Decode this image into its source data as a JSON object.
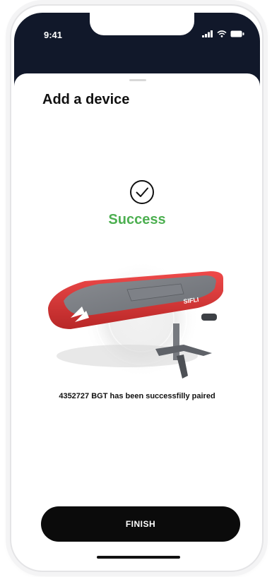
{
  "status_bar": {
    "time": "9:41",
    "icons": [
      "signal-icon",
      "wifi-icon",
      "battery-icon"
    ]
  },
  "header": {
    "title": "Add a device"
  },
  "result": {
    "icon": "check-circle-icon",
    "status": "Success",
    "status_color": "#4caf50",
    "message": "4352727 BGT has been successfilly paired"
  },
  "product": {
    "image": "efoil-board-image",
    "brand_mark": "SIFLI",
    "board_color": "#d63a3a"
  },
  "actions": {
    "finish_label": "FINISH"
  }
}
